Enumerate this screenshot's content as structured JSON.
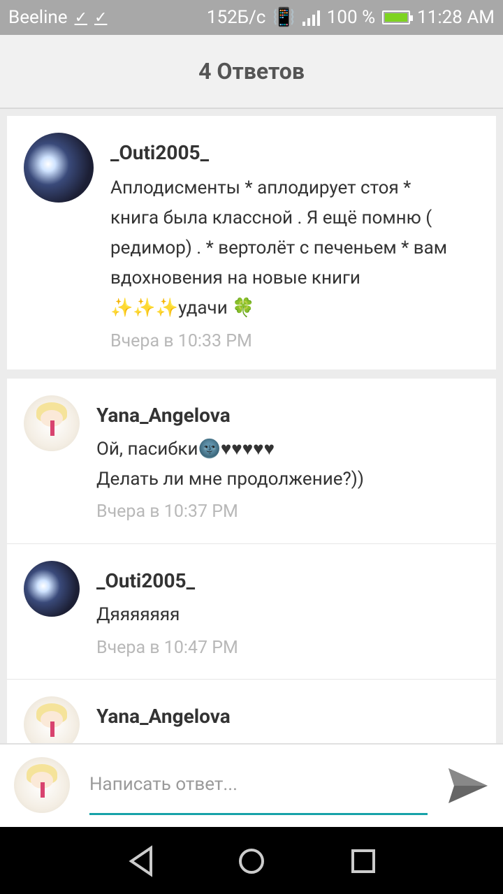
{
  "status": {
    "carrier": "Beeline",
    "speed": "152Б/с",
    "battery": "100 %",
    "time": "11:28 AM"
  },
  "header": {
    "title": "4 Ответов"
  },
  "root_comment": {
    "author": "_Outi2005_",
    "text_lines": [
      "Аплодисменты * аплодирует стоя *",
      "книга была классной . Я ещё помню (",
      "редимор) . * вертолёт с печеньем * вам",
      "вдохновения на новые книги"
    ],
    "last_line_emojis": "✨✨✨",
    "last_line_text": "удачи",
    "last_line_end_emoji": "🍀",
    "time": "Вчера в 10:33 PM"
  },
  "replies": [
    {
      "author": "Yana_Angelova",
      "lines": [
        "Ой, пасибки🌚♥♥♥♥♥",
        "Делать ли мне продолжение?))"
      ],
      "time": "Вчера в 10:37 PM"
    },
    {
      "author": "_Outi2005_",
      "lines": [
        "Дяяяяяяя"
      ],
      "time": "Вчера в 10:47 PM"
    },
    {
      "author": "Yana_Angelova"
    }
  ],
  "composer": {
    "placeholder": "Написать ответ..."
  },
  "colors": {
    "accent": "#17a2a8",
    "muted": "#b8b8b8",
    "text": "#333333"
  }
}
